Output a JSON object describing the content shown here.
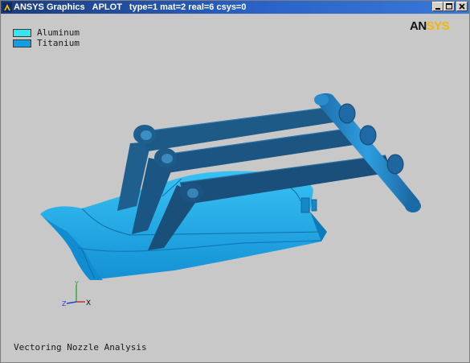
{
  "window": {
    "title_parts": [
      "ANSYS Graphics",
      "APLOT",
      "type=1 mat=2 real=6 csys=0"
    ],
    "controls": [
      "minimize",
      "maximize",
      "close"
    ]
  },
  "legend": [
    {
      "label": "Aluminum",
      "color": "#33e6f0"
    },
    {
      "label": "Titanium",
      "color": "#149ee0"
    }
  ],
  "logo": {
    "part1": "AN",
    "part2": "SYS"
  },
  "caption": "Vectoring Nozzle Analysis",
  "triad": {
    "y_label": "Y",
    "x_label": "X",
    "z_label": "Z"
  },
  "colors": {
    "background": "#c8c8c8",
    "nozzle_flap": "#1eaae8",
    "link_arm": "#1d5a86",
    "actuator_shaft": "#2890d0"
  }
}
